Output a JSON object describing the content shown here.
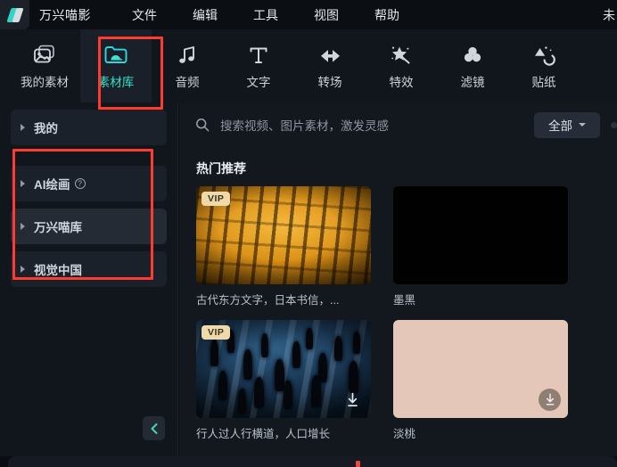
{
  "titlebar": {
    "brand": "万兴喵影",
    "logo_icon": "wondershare-logo-icon",
    "menus": [
      {
        "label": "文件"
      },
      {
        "label": "编辑"
      },
      {
        "label": "工具"
      },
      {
        "label": "视图"
      },
      {
        "label": "帮助"
      }
    ],
    "doc_name": "未"
  },
  "toolbar": {
    "items": [
      {
        "label": "我的素材",
        "icon": "image-media-icon",
        "active": false
      },
      {
        "label": "素材库",
        "icon": "folder-cloud-icon",
        "active": true
      },
      {
        "label": "音频",
        "icon": "music-note-icon",
        "active": false
      },
      {
        "label": "文字",
        "icon": "text-t-icon",
        "active": false
      },
      {
        "label": "转场",
        "icon": "transition-arrows-icon",
        "active": false
      },
      {
        "label": "特效",
        "icon": "magic-wand-star-icon",
        "active": false
      },
      {
        "label": "滤镜",
        "icon": "filter-circles-icon",
        "active": false
      },
      {
        "label": "贴纸",
        "icon": "sticker-shapes-icon",
        "active": false
      }
    ],
    "active_color": "#36e0c8"
  },
  "sidebar": {
    "items": [
      {
        "label": "我的",
        "caret": "caret-right-icon",
        "has_help": false,
        "highlighted": false
      },
      {
        "label": "AI绘画",
        "caret": "caret-right-icon",
        "has_help": true,
        "help_icon": "question-mark-icon",
        "highlighted": false
      },
      {
        "label": "万兴喵库",
        "caret": "caret-right-icon",
        "has_help": false,
        "highlighted": true
      },
      {
        "label": "视觉中国",
        "caret": "caret-right-icon",
        "has_help": false,
        "highlighted": false
      }
    ],
    "collapse_icon": "chevron-left-icon"
  },
  "search": {
    "icon": "search-icon",
    "placeholder": "搜索视频、图片素材，激发灵感",
    "filter_label": "全部",
    "filter_icon": "chevron-down-icon"
  },
  "content": {
    "section_title": "热门推荐",
    "cards": [
      {
        "caption": "古代东方文字，日本书信，...",
        "badge": "VIP",
        "art": "calligraphy",
        "download_icon": "download-icon",
        "download_style": "none"
      },
      {
        "caption": "墨黑",
        "badge": "",
        "art": "black",
        "download_icon": "download-icon",
        "download_style": "none"
      },
      {
        "caption": "行人过人行横道，人口增长",
        "badge": "VIP",
        "art": "crowd",
        "download_icon": "download-icon",
        "download_style": "plain"
      },
      {
        "caption": "淡桃",
        "badge": "",
        "art": "peach",
        "download_icon": "download-icon",
        "download_style": "solid"
      }
    ]
  },
  "colors": {
    "accent": "#36e0c8",
    "annotation": "#ff3b30",
    "vip_badge": "#efd9a8",
    "peach_swatch": "#e4c7b8",
    "playhead": "#f0463c"
  }
}
